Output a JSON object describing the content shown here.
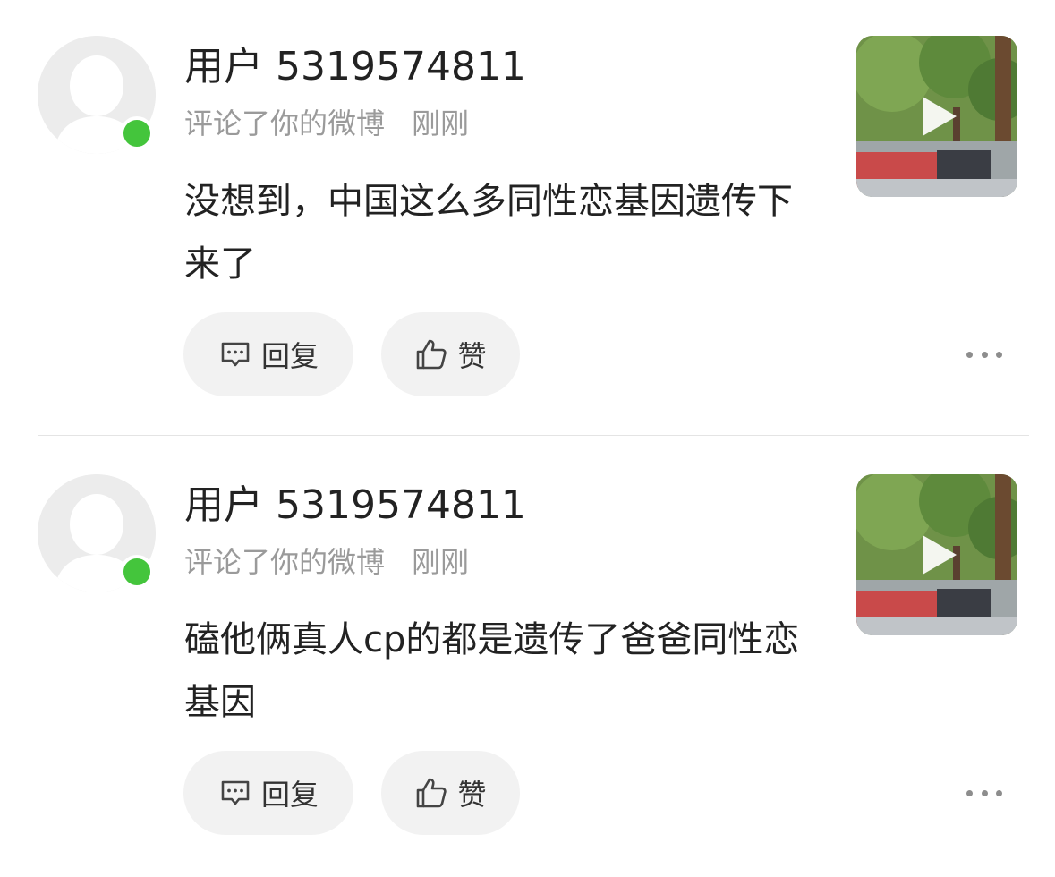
{
  "comments": [
    {
      "username": "用户 5319574811",
      "action": "评论了你的微博",
      "time": "刚刚",
      "content": "没想到，中国这么多同性恋基因遗传下来了",
      "reply_label": "回复",
      "like_label": "赞"
    },
    {
      "username": "用户 5319574811",
      "action": "评论了你的微博",
      "time": "刚刚",
      "content": "磕他俩真人cp的都是遗传了爸爸同性恋基因",
      "reply_label": "回复",
      "like_label": "赞"
    }
  ],
  "icons": {
    "reply": "comment-bubble-icon",
    "like": "thumbs-up-icon",
    "more": "more-dots-icon",
    "play": "play-icon"
  },
  "colors": {
    "online": "#44c53c",
    "meta_text": "#9a9a9a",
    "button_bg": "#f2f2f2"
  }
}
